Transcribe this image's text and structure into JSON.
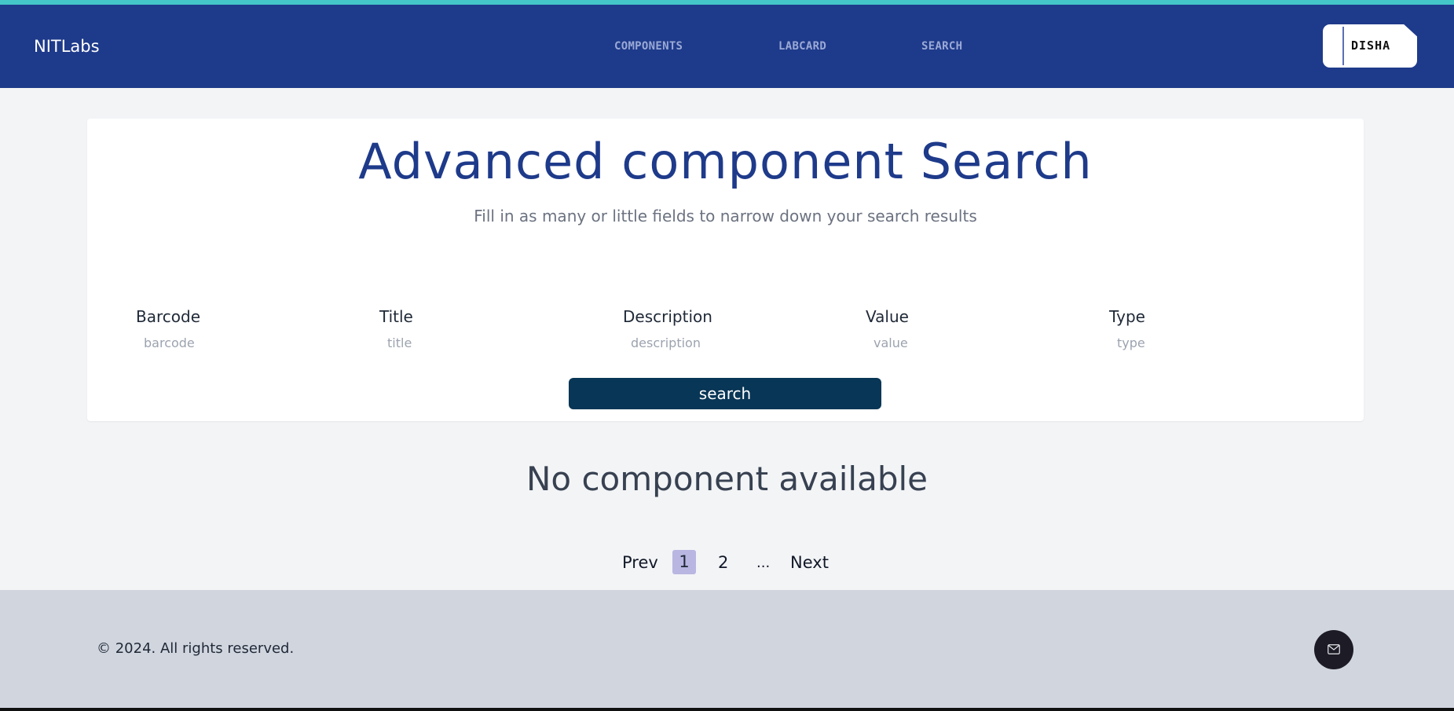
{
  "navbar": {
    "brand": "NITLabs",
    "links": [
      "COMPONENTS",
      "LABCARD",
      "SEARCH"
    ],
    "user_button": "DISHA"
  },
  "search_card": {
    "title": "Advanced component Search",
    "subtitle": "Fill in as many or little fields to narrow down your search results",
    "fields": [
      {
        "label": "Barcode",
        "placeholder": "barcode"
      },
      {
        "label": "Title",
        "placeholder": "title"
      },
      {
        "label": "Description",
        "placeholder": "description"
      },
      {
        "label": "Value",
        "placeholder": "value"
      },
      {
        "label": "Type",
        "placeholder": "type"
      }
    ],
    "search_button": "search"
  },
  "results": {
    "empty_message": "No component available"
  },
  "pagination": {
    "prev": "Prev",
    "pages": [
      "1",
      "2"
    ],
    "active_page": "1",
    "ellipsis": "...",
    "next": "Next"
  },
  "footer": {
    "copyright": "© 2024. All rights reserved.",
    "contact_icon": "mail-icon"
  },
  "colors": {
    "accent_line": "#44c6c9",
    "navbar": "#1e3a8a",
    "title": "#1e3a8a",
    "search_button": "#083656",
    "active_page": "#b9b6e2",
    "footer": "#d1d5de"
  }
}
